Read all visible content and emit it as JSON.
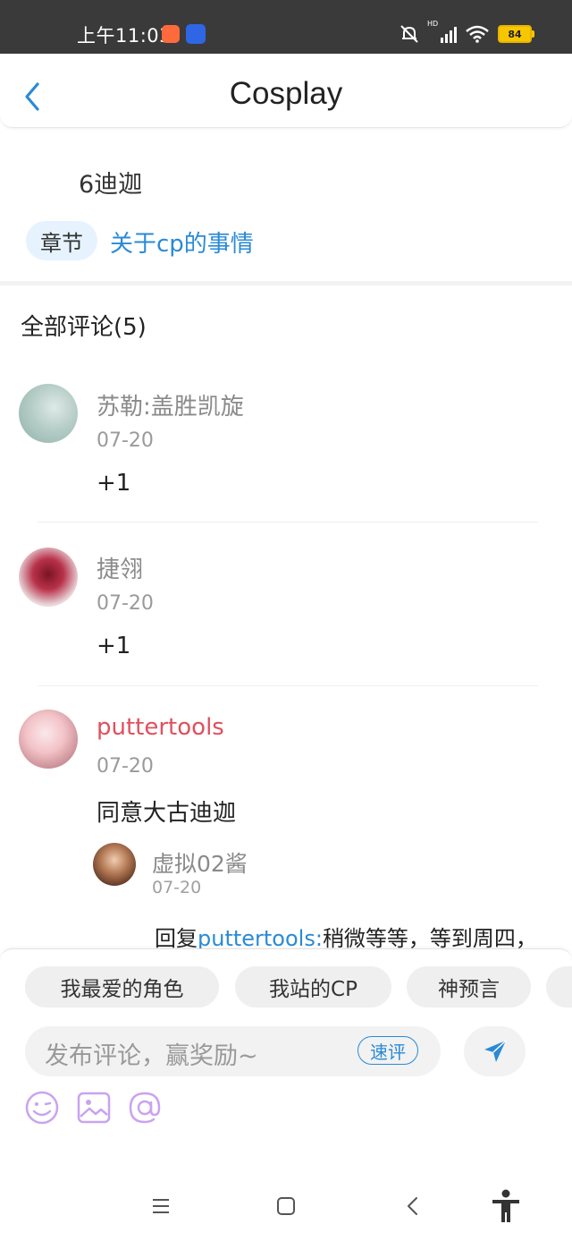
{
  "status_bar": {
    "time": "上午11:03",
    "battery": "84",
    "network_label": "HD"
  },
  "header": {
    "title": "Cosplay",
    "back_icon": "chevron-left-icon"
  },
  "post": {
    "title": "6迪迦",
    "chapter_label": "章节",
    "chapter_link": "关于cp的事情"
  },
  "comments": {
    "title": "全部评论(5)",
    "items": [
      {
        "username": "苏勒:盖胜凯旋",
        "date": "07-20",
        "text": "+1",
        "name_color": "#8a8a8a"
      },
      {
        "username": "捷翎",
        "date": "07-20",
        "text": "+1",
        "name_color": "#8a8a8a"
      },
      {
        "username": "puttertools",
        "date": "07-20",
        "text": "同意大古迪迦",
        "name_color": "#e0505e",
        "reply": {
          "username": "虚拟02酱",
          "date": "07-20",
          "prefix": "回复",
          "mention": "puttertools:",
          "text": "稍微等等，等到周四，"
        }
      }
    ]
  },
  "composer": {
    "chips": [
      "我最爱的角色",
      "我站的CP",
      "神预言"
    ],
    "placeholder": "发布评论，赢奖励~",
    "quick_label": "速评",
    "tools": [
      "emoji-icon",
      "image-icon",
      "mention-icon"
    ]
  },
  "colors": {
    "accent": "#2a8ad6",
    "highlight_user": "#e0505e",
    "tool_purple": "#c9a3f0"
  }
}
